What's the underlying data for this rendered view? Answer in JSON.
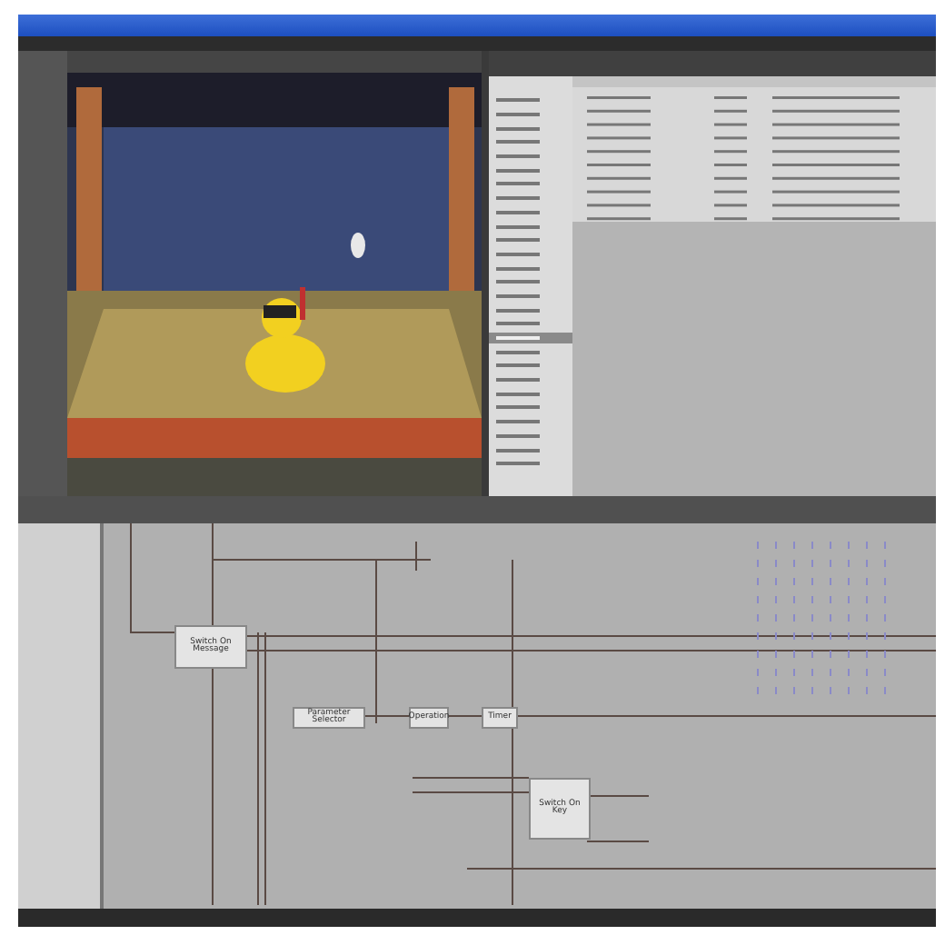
{
  "building_blocks_tree": [
    {
      "selected": false
    },
    {
      "selected": false
    },
    {
      "selected": false
    },
    {
      "selected": false
    },
    {
      "selected": false
    },
    {
      "selected": false
    },
    {
      "selected": false
    },
    {
      "selected": false
    },
    {
      "selected": false
    },
    {
      "selected": false
    },
    {
      "selected": false
    },
    {
      "selected": false
    },
    {
      "selected": false
    },
    {
      "selected": false
    },
    {
      "selected": false
    },
    {
      "selected": false
    },
    {
      "selected": false
    },
    {
      "selected": true
    },
    {
      "selected": false
    },
    {
      "selected": false
    },
    {
      "selected": false
    },
    {
      "selected": false
    },
    {
      "selected": false
    },
    {
      "selected": false
    },
    {
      "selected": false
    },
    {
      "selected": false
    },
    {
      "selected": false
    }
  ],
  "schematic": {
    "blocks": [
      {
        "label": "Switch On Message"
      },
      {
        "label": "Parameter Selector"
      },
      {
        "label": "Operation"
      },
      {
        "label": "Timer"
      },
      {
        "label": "Switch On Key"
      }
    ]
  }
}
